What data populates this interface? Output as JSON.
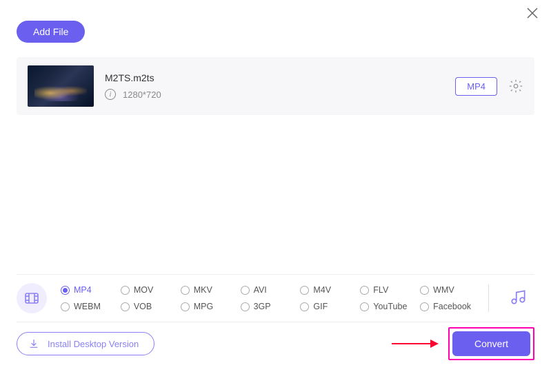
{
  "header": {
    "add_file_label": "Add File"
  },
  "file": {
    "name": "M2TS.m2ts",
    "resolution": "1280*720",
    "target_format": "MP4"
  },
  "formats": {
    "row1": [
      "MP4",
      "MOV",
      "MKV",
      "AVI",
      "M4V",
      "FLV",
      "WMV"
    ],
    "row2": [
      "WEBM",
      "VOB",
      "MPG",
      "3GP",
      "GIF",
      "YouTube",
      "Facebook"
    ],
    "selected": "MP4"
  },
  "footer": {
    "install_label": "Install Desktop Version",
    "convert_label": "Convert"
  }
}
